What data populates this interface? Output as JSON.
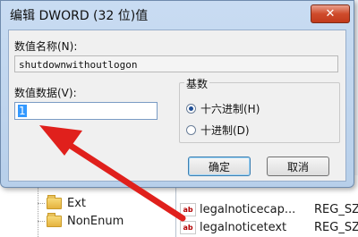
{
  "dialog": {
    "title": "编辑 DWORD (32 位)值",
    "close_glyph": "✕",
    "value_name_label": "数值名称(N):",
    "value_name": "shutdownwithoutlogon",
    "value_data_label": "数值数据(V):",
    "value_data": "1",
    "base_label": "基数",
    "radix_options": [
      {
        "label": "十六进制(H)",
        "selected": true
      },
      {
        "label": "十进制(D)",
        "selected": false
      }
    ],
    "ok_label": "确定",
    "cancel_label": "取消"
  },
  "registry": {
    "tree_items": [
      {
        "label": "Ext",
        "icon": "folder-icon"
      },
      {
        "label": "NonEnum",
        "icon": "folder-icon"
      }
    ],
    "values": [
      {
        "name": "legalnoticecap...",
        "type": "REG_SZ",
        "icon": "string-value-icon"
      },
      {
        "name": "legalnoticetext",
        "type": "REG_SZ",
        "icon": "string-value-icon"
      }
    ]
  },
  "colors": {
    "annotation_arrow": "#e0201c",
    "selection": "#3399ff"
  }
}
